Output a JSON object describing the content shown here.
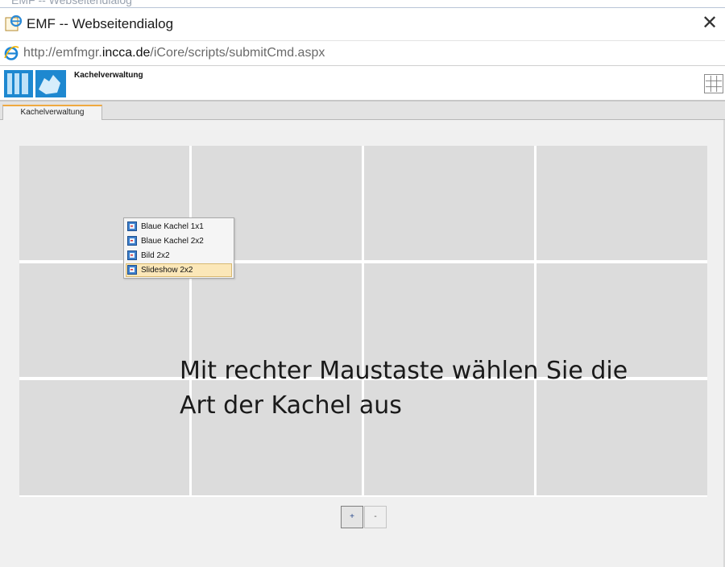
{
  "ghost_window": {
    "title": "EMF -- Webseitendialog"
  },
  "window": {
    "title": "EMF -- Webseitendialog",
    "close_glyph": "✕"
  },
  "address": {
    "url_prefix": "http://emfmgr.",
    "url_domain": "incca.de",
    "url_path": "/iCore/scripts/submitCmd.aspx"
  },
  "app": {
    "title": "Kachelverwaltung"
  },
  "tabs": [
    {
      "label": "Kachelverwaltung",
      "active": true
    }
  ],
  "tile_grid": {
    "rows": 3,
    "columns": 4,
    "tile_color": "#dcdcdc"
  },
  "context_menu": {
    "items": [
      {
        "label": "Blaue Kachel 1x1",
        "highlighted": false
      },
      {
        "label": "Blaue Kachel 2x2",
        "highlighted": false
      },
      {
        "label": "Bild 2x2",
        "highlighted": false
      },
      {
        "label": "Slideshow 2x2",
        "highlighted": true
      }
    ]
  },
  "annotation": {
    "line1": "Mit rechter Maustaste wählen Sie die",
    "line2": "Art der Kachel aus"
  },
  "controls": {
    "add_label": "+",
    "remove_label": "-"
  },
  "colors": {
    "accent_tab": "#f0a940",
    "menu_highlight": "#fbe7b8",
    "logo_blue": "#1e88d0"
  }
}
